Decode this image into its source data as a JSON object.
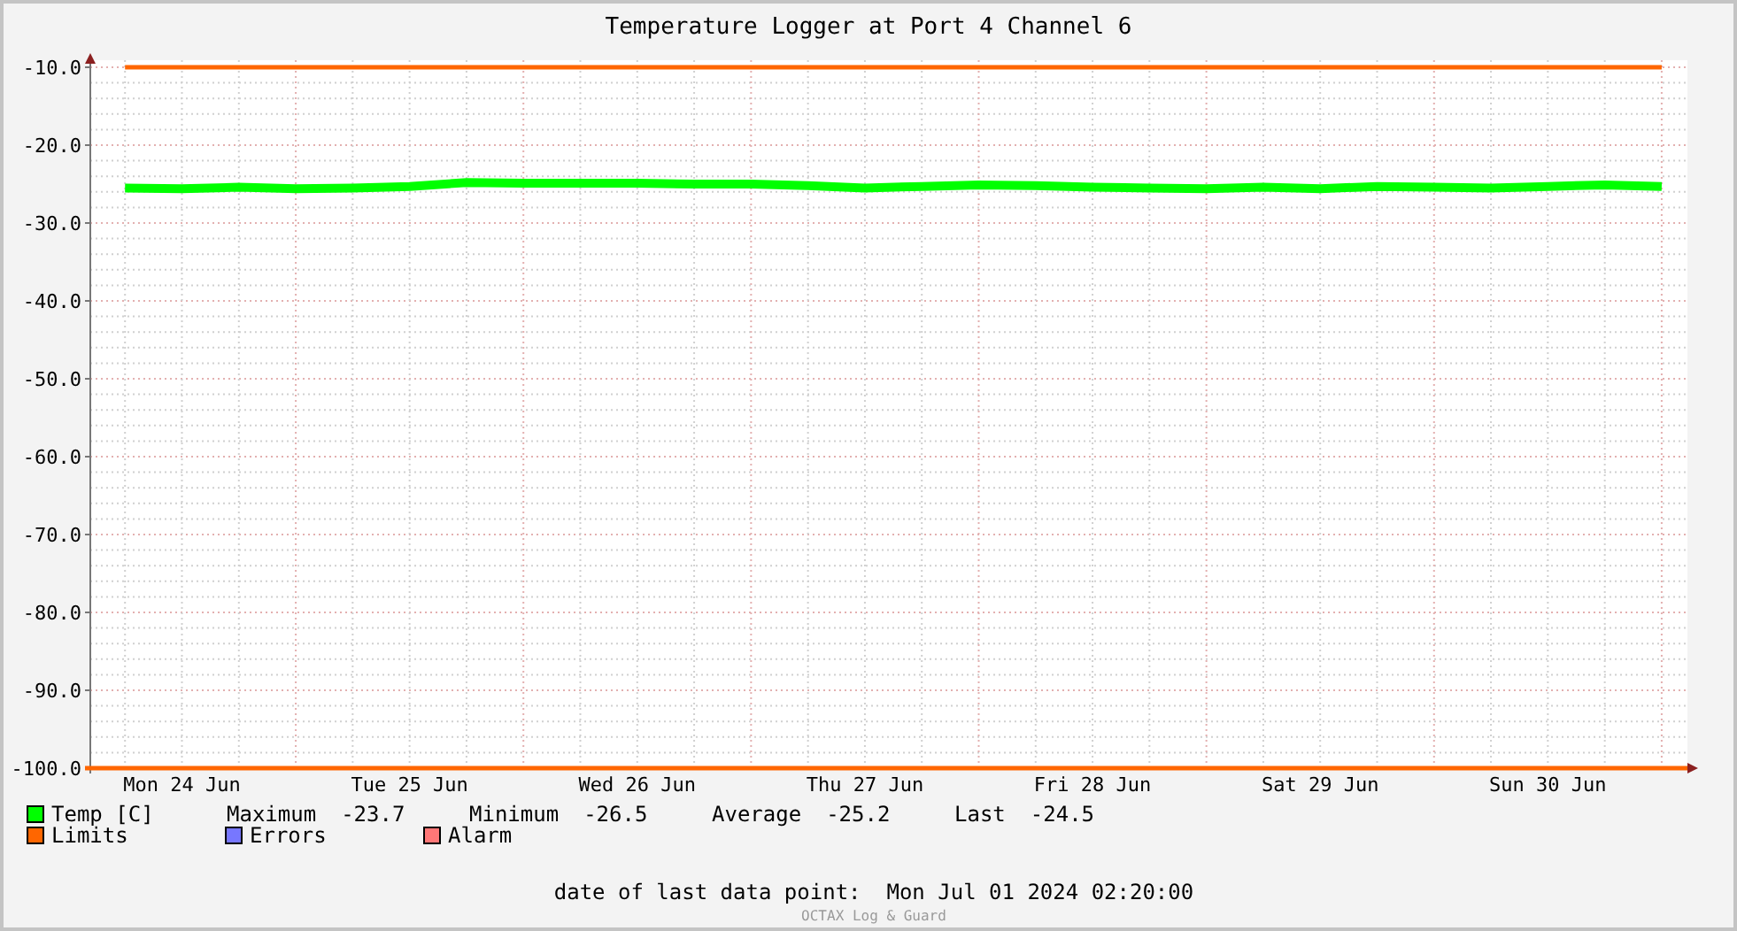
{
  "title": "Temperature Logger at Port 4 Channel 6",
  "chart": {
    "chart_data": {
      "type": "line",
      "categories": [
        null,
        "Mon 24 Jun",
        null,
        null,
        null,
        "Tue 25 Jun",
        null,
        null,
        null,
        "Wed 26 Jun",
        null,
        null,
        null,
        "Thu 27 Jun",
        null,
        null,
        null,
        "Fri 28 Jun",
        null,
        null,
        null,
        "Sat 29 Jun",
        null,
        null,
        null,
        "Sun 30 Jun",
        null,
        null
      ],
      "ylim": [
        -100,
        -10
      ],
      "grid": true,
      "yticks": [
        {
          "value": -10,
          "label": "-10.0"
        },
        {
          "value": -20,
          "label": "-20.0"
        },
        {
          "value": -30,
          "label": "-30.0"
        },
        {
          "value": -40,
          "label": "-40.0"
        },
        {
          "value": -50,
          "label": "-50.0"
        },
        {
          "value": -60,
          "label": "-60.0"
        },
        {
          "value": -70,
          "label": "-70.0"
        },
        {
          "value": -80,
          "label": "-80.0"
        },
        {
          "value": -90,
          "label": "-90.0"
        },
        {
          "value": -100,
          "label": "-100.0"
        }
      ],
      "series": [
        {
          "name": "Temp [C]",
          "color": "#00ff00",
          "values": [
            -25.5,
            -25.6,
            -25.4,
            -25.6,
            -25.5,
            -25.3,
            -24.8,
            -24.9,
            -24.9,
            -24.9,
            -25.0,
            -25.0,
            -25.2,
            -25.5,
            -25.3,
            -25.1,
            -25.2,
            -25.4,
            -25.5,
            -25.6,
            -25.4,
            -25.6,
            -25.3,
            -25.4,
            -25.5,
            -25.3,
            -25.1,
            -25.3
          ]
        },
        {
          "name": "Limits",
          "color": "#ff6600",
          "values": [
            -10,
            -10,
            -10,
            -10,
            -10,
            -10,
            -10,
            -10,
            -10,
            -10,
            -10,
            -10,
            -10,
            -10,
            -10,
            -10,
            -10,
            -10,
            -10,
            -10,
            -10,
            -10,
            -10,
            -10,
            -10,
            -10,
            -10,
            -10
          ]
        }
      ]
    }
  },
  "legend_rows": [
    [
      {
        "kind": "series"
      },
      {
        "kind": "stat",
        "label": "Maximum",
        "value": "-23.7"
      },
      {
        "kind": "stat",
        "label": "Minimum",
        "value": "-26.5"
      },
      {
        "kind": "stat",
        "label": "Average",
        "value": "-25.2"
      },
      {
        "kind": "stat",
        "label": "Last",
        "value": "-24.5"
      }
    ],
    [
      {
        "kind": "series"
      },
      {
        "kind": "entry",
        "label": "Errors",
        "color": "#7777ff"
      },
      {
        "kind": "entry",
        "label": "Alarm",
        "color": "#ff7777"
      }
    ]
  ],
  "footer": {
    "label": "date of last data point:",
    "value": "Mon Jul 01 2024 02:20:00"
  },
  "credit": "OCTAX Log & Guard"
}
